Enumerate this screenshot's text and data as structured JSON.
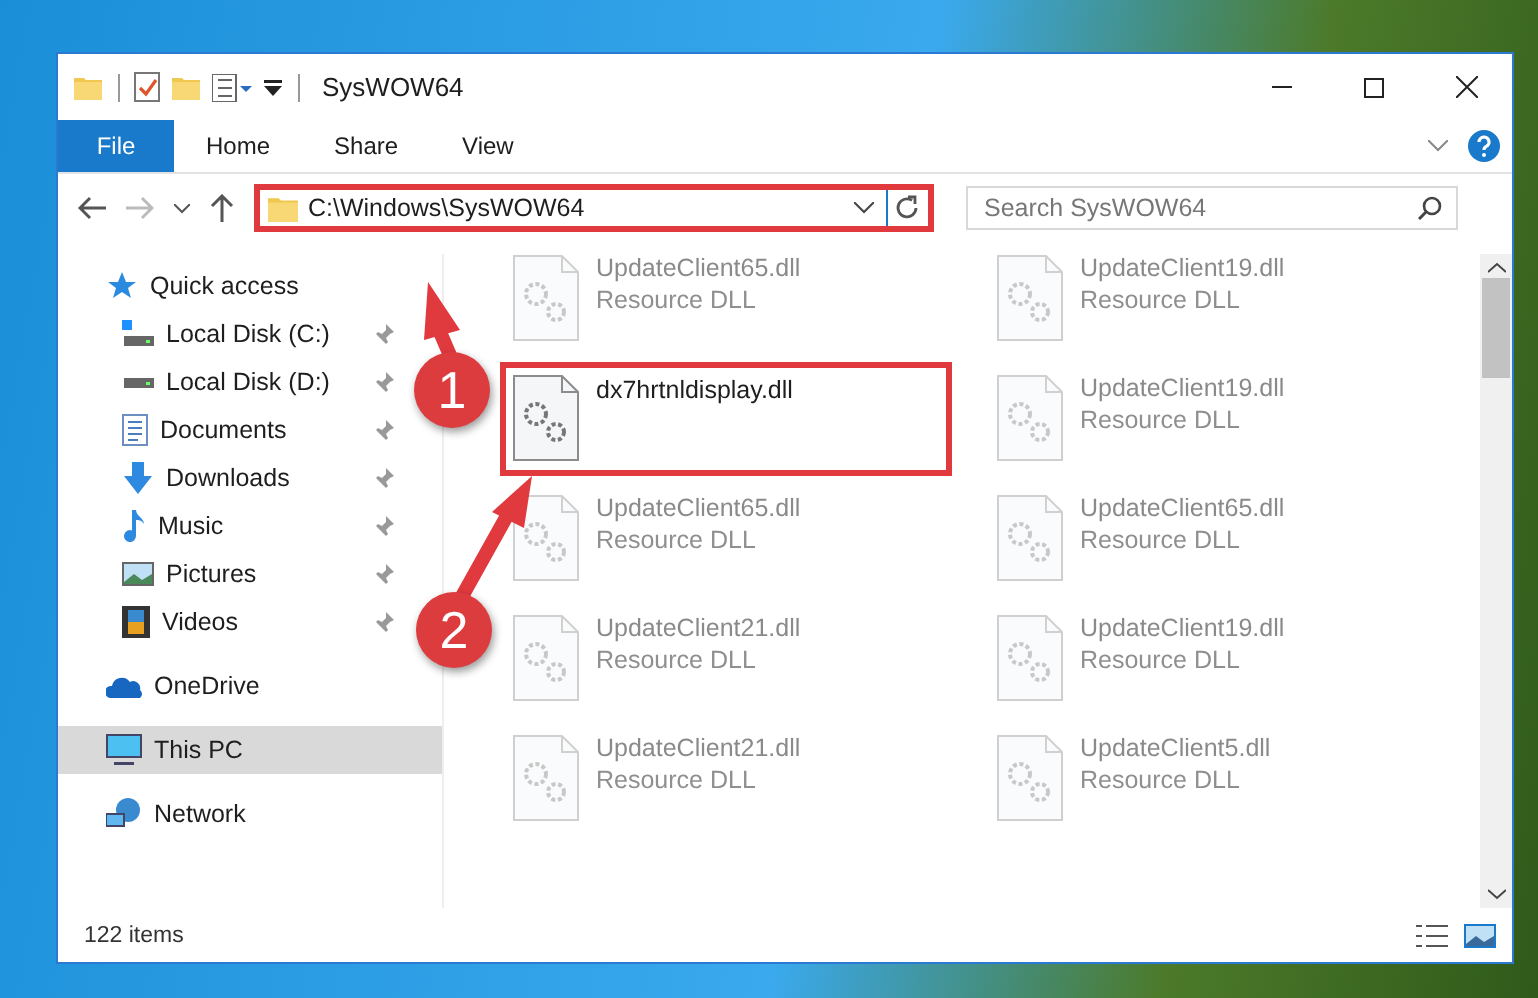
{
  "window": {
    "title": "SysWOW64"
  },
  "ribbon_tabs": [
    {
      "label": "File",
      "kind": "menu",
      "selected": false
    },
    {
      "label": "Home",
      "kind": "tab",
      "selected": false
    },
    {
      "label": "Share",
      "kind": "tab",
      "selected": false
    },
    {
      "label": "View",
      "kind": "tab",
      "selected": false
    }
  ],
  "address_bar": {
    "path": "C:\\Windows\\SysWOW64",
    "highlighted": true
  },
  "search": {
    "placeholder": "Search SysWOW64"
  },
  "sidebar": {
    "items": [
      {
        "label": "Quick access",
        "kind": "star",
        "selected": false,
        "children": [
          {
            "label": "Local Disk (C:)",
            "kind": "system-drive",
            "pinned": true,
            "selected": false
          },
          {
            "label": "Local Disk (D:)",
            "kind": "drive",
            "pinned": true,
            "selected": false
          },
          {
            "label": "Documents",
            "kind": "document",
            "pinned": true,
            "selected": false
          },
          {
            "label": "Downloads",
            "kind": "download",
            "pinned": true,
            "selected": false
          },
          {
            "label": "Music",
            "kind": "music",
            "pinned": true,
            "selected": false
          },
          {
            "label": "Pictures",
            "kind": "picture",
            "pinned": true,
            "selected": false
          },
          {
            "label": "Videos",
            "kind": "video",
            "pinned": true,
            "selected": false
          }
        ]
      },
      {
        "label": "OneDrive",
        "kind": "cloud",
        "selected": false
      },
      {
        "label": "This PC",
        "kind": "pc",
        "selected": true
      },
      {
        "label": "Network",
        "kind": "network",
        "selected": false
      }
    ]
  },
  "files": [
    {
      "name": "UpdateClient65.dll",
      "type": "Resource DLL",
      "dimmed": true,
      "highlighted": false
    },
    {
      "name": "UpdateClient19.dll",
      "type": "Resource DLL",
      "dimmed": true,
      "highlighted": false
    },
    {
      "name": "dx7hrtnldisplay.dll",
      "dimmed": false,
      "highlighted": true
    },
    {
      "name": "UpdateClient19.dll",
      "type": "Resource DLL",
      "dimmed": true,
      "highlighted": false
    },
    {
      "name": "UpdateClient65.dll",
      "type": "Resource DLL",
      "dimmed": true,
      "highlighted": false
    },
    {
      "name": "UpdateClient65.dll",
      "type": "Resource DLL",
      "dimmed": true,
      "highlighted": false
    },
    {
      "name": "UpdateClient21.dll",
      "type": "Resource DLL",
      "dimmed": true,
      "highlighted": false
    },
    {
      "name": "UpdateClient19.dll",
      "type": "Resource DLL",
      "dimmed": true,
      "highlighted": false
    },
    {
      "name": "UpdateClient21.dll",
      "type": "Resource DLL",
      "dimmed": true,
      "highlighted": false
    },
    {
      "name": "UpdateClient5.dll",
      "type": "Resource DLL",
      "dimmed": true,
      "highlighted": false
    }
  ],
  "status_bar": {
    "item_count": "122 items"
  },
  "annotations": [
    {
      "number": "1"
    },
    {
      "number": "2"
    }
  ]
}
